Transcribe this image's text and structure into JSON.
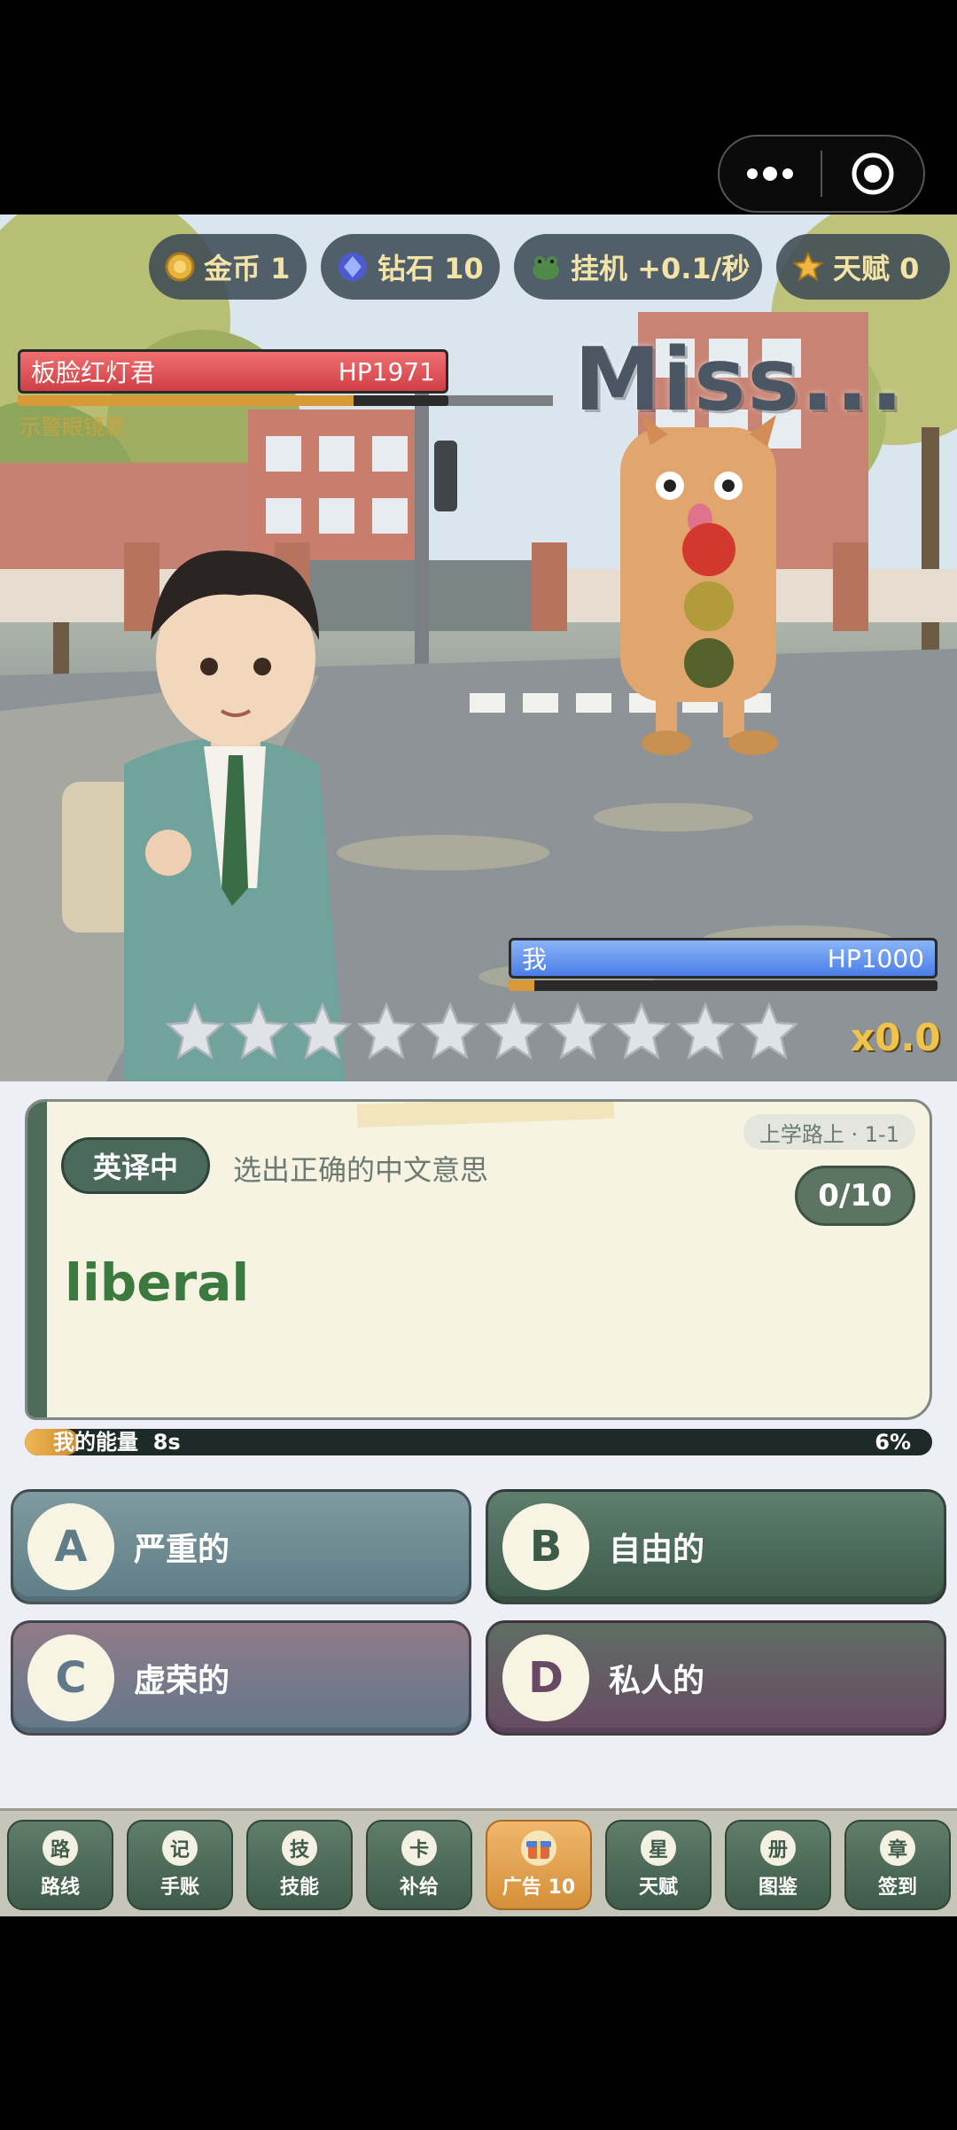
{
  "capsule": {
    "more_icon": "more-dots-icon",
    "close_icon": "target-circle-icon"
  },
  "resources": [
    {
      "icon": "gold-coin-icon",
      "label": "金币 1"
    },
    {
      "icon": "diamond-icon",
      "label": "钻石 10"
    },
    {
      "icon": "idle-frog-icon",
      "label": "挂机 +0.1/秒"
    },
    {
      "icon": "star-icon",
      "label": "天赋 0"
    }
  ],
  "enemy": {
    "name": "板脸红灯君",
    "hp": "HP1971",
    "hp_fraction": 1.0,
    "sub_fraction": 0.78,
    "tag": "示警眼镜君"
  },
  "battle": {
    "miss_text": "Miss...",
    "stars_total": 10,
    "stars_filled": 0,
    "multiplier": "x0.0"
  },
  "player": {
    "name": "我",
    "hp": "HP1000",
    "sub_fraction": 0.06
  },
  "question": {
    "mode": "英译中",
    "instruction": "选出正确的中文意思",
    "stage": "上学路上 · 1-1",
    "progress": "0/10",
    "word": "liberal"
  },
  "energy": {
    "label": "我的能量",
    "timer": "8s",
    "percent": "6%",
    "fraction": 0.06
  },
  "options": [
    {
      "letter": "A",
      "text": "严重的"
    },
    {
      "letter": "B",
      "text": "自由的"
    },
    {
      "letter": "C",
      "text": "虚荣的"
    },
    {
      "letter": "D",
      "text": "私人的"
    }
  ],
  "nav": [
    {
      "icon": "路",
      "label": "路线"
    },
    {
      "icon": "记",
      "label": "手账"
    },
    {
      "icon": "技",
      "label": "技能"
    },
    {
      "icon": "卡",
      "label": "补给"
    },
    {
      "icon": "ad-gift-icon",
      "label": "广告 10",
      "active": true
    },
    {
      "icon": "星",
      "label": "天赋"
    },
    {
      "icon": "册",
      "label": "图鉴"
    },
    {
      "icon": "章",
      "label": "签到"
    }
  ]
}
